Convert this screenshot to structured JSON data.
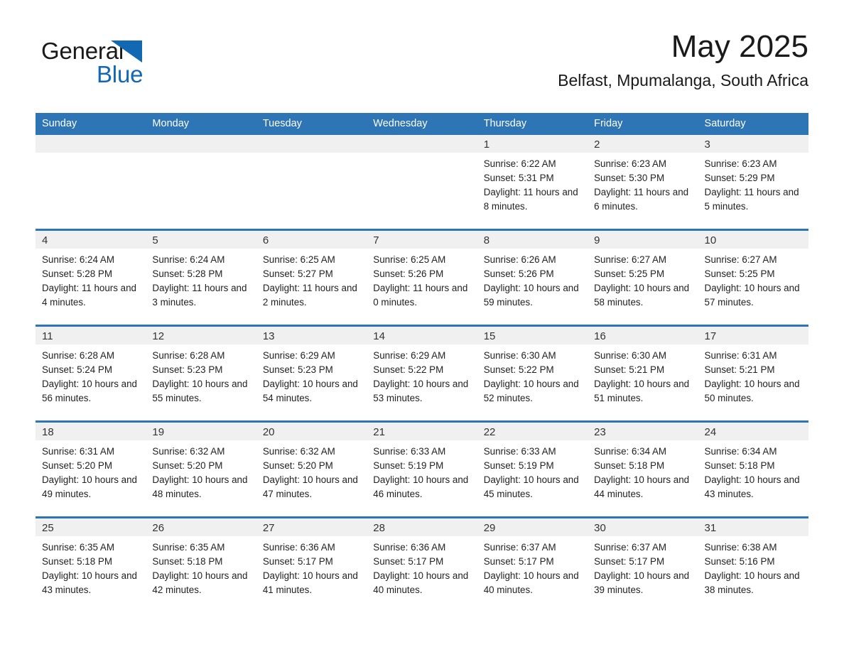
{
  "brand": {
    "name_part1": "General",
    "name_part2": "Blue",
    "accent_color": "#1268b3"
  },
  "header": {
    "month_year": "May 2025",
    "location": "Belfast, Mpumalanga, South Africa"
  },
  "calendar": {
    "header_color": "#2e75b6",
    "daynum_strip_color": "#f0f0f0",
    "weekday_headers": [
      "Sunday",
      "Monday",
      "Tuesday",
      "Wednesday",
      "Thursday",
      "Friday",
      "Saturday"
    ],
    "weeks": [
      [
        {
          "day": "",
          "sunrise": "",
          "sunset": "",
          "daylight": "",
          "empty": true
        },
        {
          "day": "",
          "sunrise": "",
          "sunset": "",
          "daylight": "",
          "empty": true
        },
        {
          "day": "",
          "sunrise": "",
          "sunset": "",
          "daylight": "",
          "empty": true
        },
        {
          "day": "",
          "sunrise": "",
          "sunset": "",
          "daylight": "",
          "empty": true
        },
        {
          "day": "1",
          "sunrise": "Sunrise: 6:22 AM",
          "sunset": "Sunset: 5:31 PM",
          "daylight": "Daylight: 11 hours and 8 minutes.",
          "empty": false
        },
        {
          "day": "2",
          "sunrise": "Sunrise: 6:23 AM",
          "sunset": "Sunset: 5:30 PM",
          "daylight": "Daylight: 11 hours and 6 minutes.",
          "empty": false
        },
        {
          "day": "3",
          "sunrise": "Sunrise: 6:23 AM",
          "sunset": "Sunset: 5:29 PM",
          "daylight": "Daylight: 11 hours and 5 minutes.",
          "empty": false
        }
      ],
      [
        {
          "day": "4",
          "sunrise": "Sunrise: 6:24 AM",
          "sunset": "Sunset: 5:28 PM",
          "daylight": "Daylight: 11 hours and 4 minutes.",
          "empty": false
        },
        {
          "day": "5",
          "sunrise": "Sunrise: 6:24 AM",
          "sunset": "Sunset: 5:28 PM",
          "daylight": "Daylight: 11 hours and 3 minutes.",
          "empty": false
        },
        {
          "day": "6",
          "sunrise": "Sunrise: 6:25 AM",
          "sunset": "Sunset: 5:27 PM",
          "daylight": "Daylight: 11 hours and 2 minutes.",
          "empty": false
        },
        {
          "day": "7",
          "sunrise": "Sunrise: 6:25 AM",
          "sunset": "Sunset: 5:26 PM",
          "daylight": "Daylight: 11 hours and 0 minutes.",
          "empty": false
        },
        {
          "day": "8",
          "sunrise": "Sunrise: 6:26 AM",
          "sunset": "Sunset: 5:26 PM",
          "daylight": "Daylight: 10 hours and 59 minutes.",
          "empty": false
        },
        {
          "day": "9",
          "sunrise": "Sunrise: 6:27 AM",
          "sunset": "Sunset: 5:25 PM",
          "daylight": "Daylight: 10 hours and 58 minutes.",
          "empty": false
        },
        {
          "day": "10",
          "sunrise": "Sunrise: 6:27 AM",
          "sunset": "Sunset: 5:25 PM",
          "daylight": "Daylight: 10 hours and 57 minutes.",
          "empty": false
        }
      ],
      [
        {
          "day": "11",
          "sunrise": "Sunrise: 6:28 AM",
          "sunset": "Sunset: 5:24 PM",
          "daylight": "Daylight: 10 hours and 56 minutes.",
          "empty": false
        },
        {
          "day": "12",
          "sunrise": "Sunrise: 6:28 AM",
          "sunset": "Sunset: 5:23 PM",
          "daylight": "Daylight: 10 hours and 55 minutes.",
          "empty": false
        },
        {
          "day": "13",
          "sunrise": "Sunrise: 6:29 AM",
          "sunset": "Sunset: 5:23 PM",
          "daylight": "Daylight: 10 hours and 54 minutes.",
          "empty": false
        },
        {
          "day": "14",
          "sunrise": "Sunrise: 6:29 AM",
          "sunset": "Sunset: 5:22 PM",
          "daylight": "Daylight: 10 hours and 53 minutes.",
          "empty": false
        },
        {
          "day": "15",
          "sunrise": "Sunrise: 6:30 AM",
          "sunset": "Sunset: 5:22 PM",
          "daylight": "Daylight: 10 hours and 52 minutes.",
          "empty": false
        },
        {
          "day": "16",
          "sunrise": "Sunrise: 6:30 AM",
          "sunset": "Sunset: 5:21 PM",
          "daylight": "Daylight: 10 hours and 51 minutes.",
          "empty": false
        },
        {
          "day": "17",
          "sunrise": "Sunrise: 6:31 AM",
          "sunset": "Sunset: 5:21 PM",
          "daylight": "Daylight: 10 hours and 50 minutes.",
          "empty": false
        }
      ],
      [
        {
          "day": "18",
          "sunrise": "Sunrise: 6:31 AM",
          "sunset": "Sunset: 5:20 PM",
          "daylight": "Daylight: 10 hours and 49 minutes.",
          "empty": false
        },
        {
          "day": "19",
          "sunrise": "Sunrise: 6:32 AM",
          "sunset": "Sunset: 5:20 PM",
          "daylight": "Daylight: 10 hours and 48 minutes.",
          "empty": false
        },
        {
          "day": "20",
          "sunrise": "Sunrise: 6:32 AM",
          "sunset": "Sunset: 5:20 PM",
          "daylight": "Daylight: 10 hours and 47 minutes.",
          "empty": false
        },
        {
          "day": "21",
          "sunrise": "Sunrise: 6:33 AM",
          "sunset": "Sunset: 5:19 PM",
          "daylight": "Daylight: 10 hours and 46 minutes.",
          "empty": false
        },
        {
          "day": "22",
          "sunrise": "Sunrise: 6:33 AM",
          "sunset": "Sunset: 5:19 PM",
          "daylight": "Daylight: 10 hours and 45 minutes.",
          "empty": false
        },
        {
          "day": "23",
          "sunrise": "Sunrise: 6:34 AM",
          "sunset": "Sunset: 5:18 PM",
          "daylight": "Daylight: 10 hours and 44 minutes.",
          "empty": false
        },
        {
          "day": "24",
          "sunrise": "Sunrise: 6:34 AM",
          "sunset": "Sunset: 5:18 PM",
          "daylight": "Daylight: 10 hours and 43 minutes.",
          "empty": false
        }
      ],
      [
        {
          "day": "25",
          "sunrise": "Sunrise: 6:35 AM",
          "sunset": "Sunset: 5:18 PM",
          "daylight": "Daylight: 10 hours and 43 minutes.",
          "empty": false
        },
        {
          "day": "26",
          "sunrise": "Sunrise: 6:35 AM",
          "sunset": "Sunset: 5:18 PM",
          "daylight": "Daylight: 10 hours and 42 minutes.",
          "empty": false
        },
        {
          "day": "27",
          "sunrise": "Sunrise: 6:36 AM",
          "sunset": "Sunset: 5:17 PM",
          "daylight": "Daylight: 10 hours and 41 minutes.",
          "empty": false
        },
        {
          "day": "28",
          "sunrise": "Sunrise: 6:36 AM",
          "sunset": "Sunset: 5:17 PM",
          "daylight": "Daylight: 10 hours and 40 minutes.",
          "empty": false
        },
        {
          "day": "29",
          "sunrise": "Sunrise: 6:37 AM",
          "sunset": "Sunset: 5:17 PM",
          "daylight": "Daylight: 10 hours and 40 minutes.",
          "empty": false
        },
        {
          "day": "30",
          "sunrise": "Sunrise: 6:37 AM",
          "sunset": "Sunset: 5:17 PM",
          "daylight": "Daylight: 10 hours and 39 minutes.",
          "empty": false
        },
        {
          "day": "31",
          "sunrise": "Sunrise: 6:38 AM",
          "sunset": "Sunset: 5:16 PM",
          "daylight": "Daylight: 10 hours and 38 minutes.",
          "empty": false
        }
      ]
    ]
  }
}
